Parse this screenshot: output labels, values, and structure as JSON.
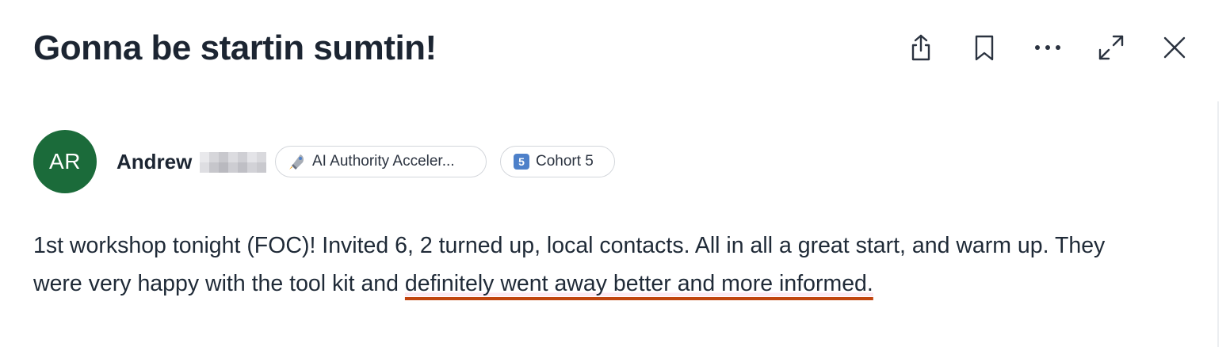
{
  "post": {
    "title": "Gonna be startin sumtin!",
    "author": {
      "initials": "AR",
      "name": "Andrew",
      "avatar_color": "#1b6b3a"
    },
    "badges": [
      {
        "icon": "rocket-icon",
        "label": "AI Authority Acceler..."
      },
      {
        "icon": "number-5-icon",
        "label": "Cohort 5",
        "icon_text": "5"
      }
    ],
    "body": {
      "before_highlight": "1st workshop tonight (FOC)! Invited 6, 2 turned up, local contacts. All in all a great start, and warm up. They were very happy with the tool kit and ",
      "highlight": "definitely went away better and more informed."
    }
  },
  "toolbar": {
    "items": [
      {
        "icon": "share-icon"
      },
      {
        "icon": "bookmark-icon"
      },
      {
        "icon": "more-icon"
      },
      {
        "icon": "expand-icon"
      },
      {
        "icon": "close-icon"
      }
    ]
  },
  "colors": {
    "highlight_underline": "#c1440e",
    "title_text": "#1c2532"
  }
}
